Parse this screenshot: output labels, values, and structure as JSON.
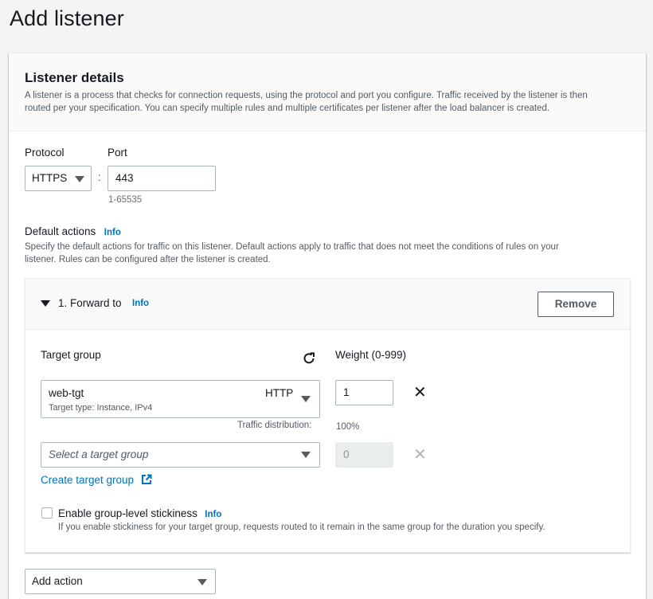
{
  "page": {
    "title": "Add listener"
  },
  "listener_details": {
    "heading": "Listener details",
    "description_line1": "A listener is a process that checks for connection requests, using the protocol and port you configure. Traffic received by the listener is then",
    "description_line2": "routed per your specification. You can specify multiple rules and multiple certificates per listener after the load balancer is created."
  },
  "protocol": {
    "label": "Protocol",
    "value": "HTTPS",
    "separator": ":"
  },
  "port": {
    "label": "Port",
    "value": "443",
    "hint": "1-65535"
  },
  "default_actions": {
    "label": "Default actions",
    "info": "Info",
    "description_line1": "Specify the default actions for traffic on this listener. Default actions apply to traffic that does not meet the conditions of rules on your",
    "description_line2": "listener. Rules can be configured after the listener is created."
  },
  "forward": {
    "title": "1. Forward to",
    "info": "Info",
    "remove_label": "Remove",
    "target_group_label": "Target group",
    "weight_label": "Weight (0-999)",
    "targets": [
      {
        "name": "web-tgt",
        "protocol": "HTTP",
        "subtitle": "Target type: Instance, IPv4",
        "weight": "1"
      },
      {
        "placeholder": "Select a target group",
        "weight": "0"
      }
    ],
    "traffic_distribution_label": "Traffic distribution:",
    "traffic_distribution_value": "100%",
    "create_target_group": "Create target group",
    "stickiness_label": "Enable group-level stickiness",
    "stickiness_info": "Info",
    "stickiness_description": "If you enable stickiness for your target group, requests routed to it remain in the same group for the duration you specify."
  },
  "add_action": {
    "label": "Add action"
  },
  "colors": {
    "link": "#0073bb",
    "text": "#16191f",
    "muted": "#545b64",
    "background": "#f2f3f3"
  }
}
